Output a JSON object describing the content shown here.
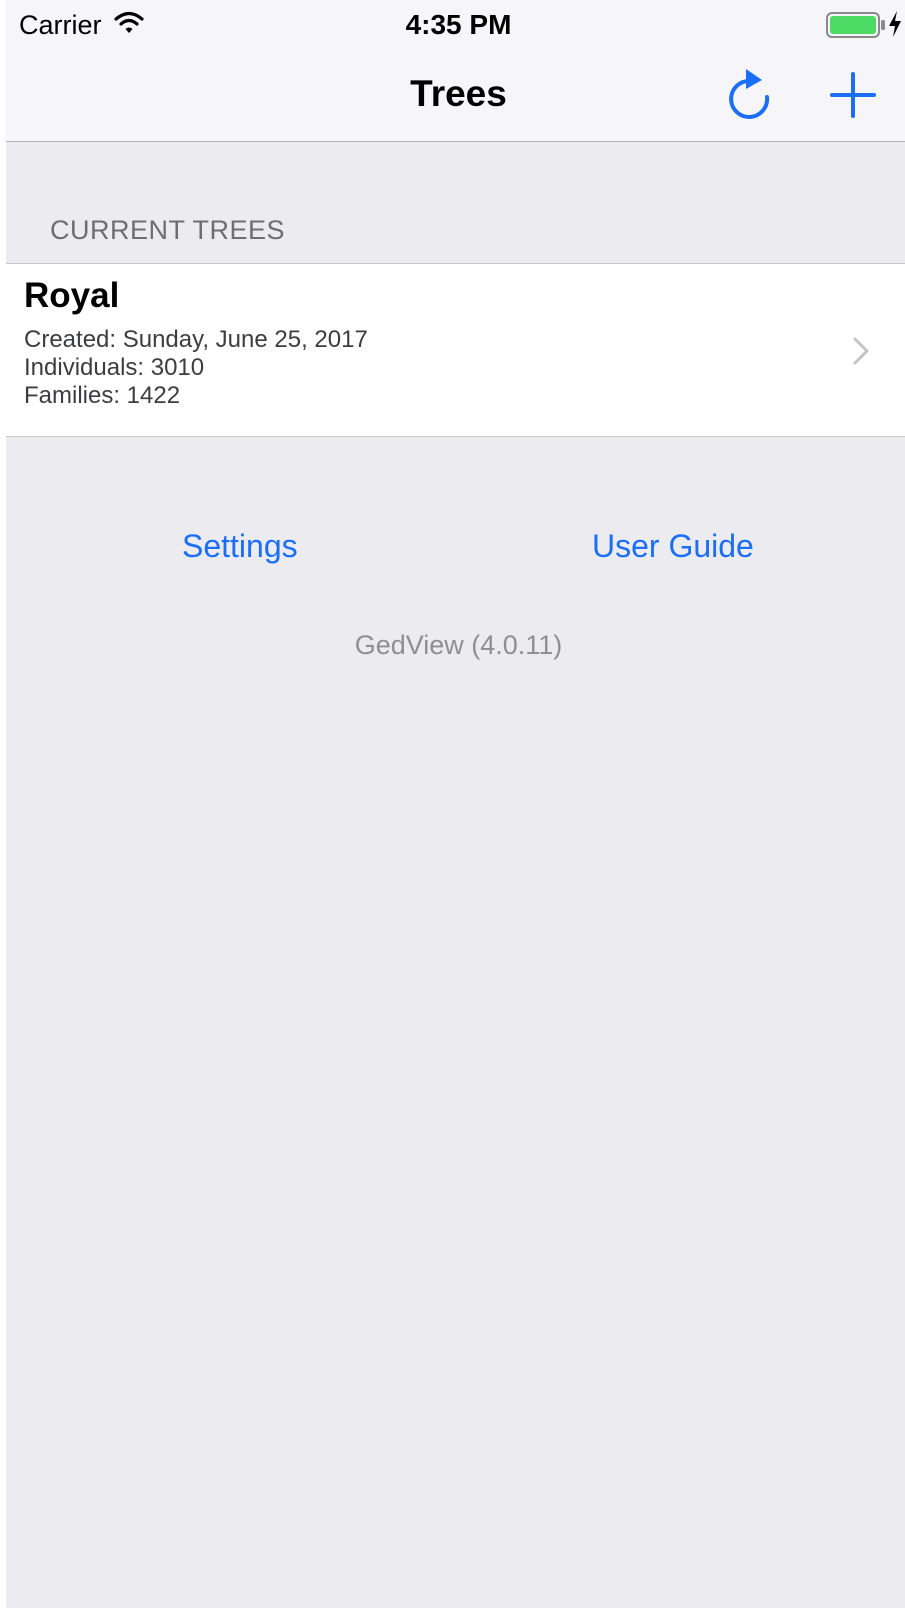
{
  "status_bar": {
    "carrier": "Carrier",
    "time": "4:35 PM",
    "icons": [
      "wifi-icon",
      "battery-icon",
      "charging-bolt-icon"
    ],
    "battery_color": "#4cd964"
  },
  "nav_bar": {
    "title": "Trees",
    "right_buttons": [
      "refresh-icon",
      "add-icon"
    ],
    "accent_color": "#1a6ef7"
  },
  "section": {
    "header": "CURRENT TREES"
  },
  "trees": [
    {
      "name": "Royal",
      "created": "Created: Sunday, June 25, 2017",
      "individuals": "Individuals: 3010",
      "families": "Families: 1422"
    }
  ],
  "links": {
    "settings": "Settings",
    "user_guide": "User Guide"
  },
  "footer": {
    "version": "GedView (4.0.11)"
  }
}
